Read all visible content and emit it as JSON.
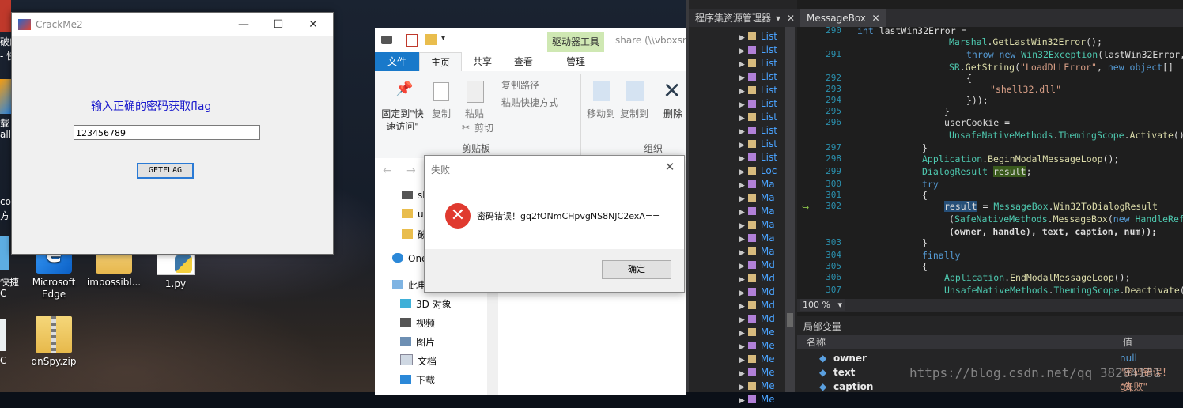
{
  "desktop": {
    "icons": [
      {
        "label": "Microsoft Edge",
        "line1": "Microsoft",
        "line2": "Edge"
      },
      {
        "label": "impossibl...",
        "line1": "impossibl...",
        "line2": ""
      },
      {
        "label": "1.py",
        "line1": "1.py",
        "line2": ""
      },
      {
        "label": "dnSpy.zip",
        "line1": "dnSpy.zip",
        "line2": ""
      }
    ],
    "partial_labels": [
      "破解",
      "- 快",
      "载",
      "all",
      "co",
      "方",
      "快捷",
      "C",
      "C"
    ]
  },
  "crackme": {
    "title": "CrackMe2",
    "prompt": "输入正确的密码获取flag",
    "password_value": "123456789",
    "button": "GETFLAG",
    "min": "—",
    "max": "☐",
    "close": "✕"
  },
  "explorer": {
    "address": "share (\\\\vboxsr",
    "context_tab": "驱动器工具",
    "tabs": [
      "文件",
      "主页",
      "共享",
      "查看",
      "管理"
    ],
    "ribbon": {
      "pin": "固定到\"快\n速访问\"",
      "copy": "复制",
      "paste": "粘贴",
      "copy_path": "复制路径",
      "paste_shortcut": "粘贴快捷方式",
      "cut": "剪切",
      "group_clipboard": "剪贴板",
      "move_to": "移动到",
      "copy_to": "复制到",
      "delete": "删除",
      "group_organize": "组织"
    },
    "nav": [
      "sh",
      "uc",
      "破",
      "One",
      "此电",
      "3D 对象",
      "视频",
      "图片",
      "文档",
      "下载"
    ]
  },
  "dialog": {
    "title": "失败",
    "message": "密码错误！gq2fONmCHpvgNS8NJC2exA==",
    "ok": "确定"
  },
  "vs": {
    "assembly_pane_title": "程序集资源管理器",
    "tree_items": [
      "List",
      "List",
      "List",
      "List",
      "List",
      "List",
      "List",
      "List",
      "List",
      "List",
      "Loc",
      "Ma",
      "Ma",
      "Ma",
      "Ma",
      "Ma",
      "Ma",
      "Md",
      "Md",
      "Md",
      "Md",
      "Md",
      "Me",
      "Me",
      "Me",
      "Me",
      "Me",
      "Me"
    ],
    "tab_title": "MessageBox",
    "zoom": "100 %",
    "locals_title": "局部变量",
    "col_name": "名称",
    "col_value": "值",
    "locals": [
      {
        "name": "owner",
        "value": "null"
      },
      {
        "name": "text",
        "value": "\"密码错误！gq"
      },
      {
        "name": "caption",
        "value": "\"失败\""
      }
    ],
    "line_numbers": [
      "290",
      "291",
      "",
      "292",
      "293",
      "294",
      "295",
      "296",
      "",
      "297",
      "298",
      "299",
      "300",
      "301",
      "302",
      "",
      "",
      "303",
      "304",
      "305",
      "306",
      "307"
    ],
    "watermark": "https://blog.csdn.net/qq_38204181"
  },
  "colors": {
    "vs_bg": "#1e1e1e",
    "keyword": "#569cd6",
    "type": "#4ec9b0",
    "method": "#dcdcaa",
    "string": "#d69d85",
    "error_red": "#e03a2f",
    "crackme_prompt": "#1a1acc"
  }
}
